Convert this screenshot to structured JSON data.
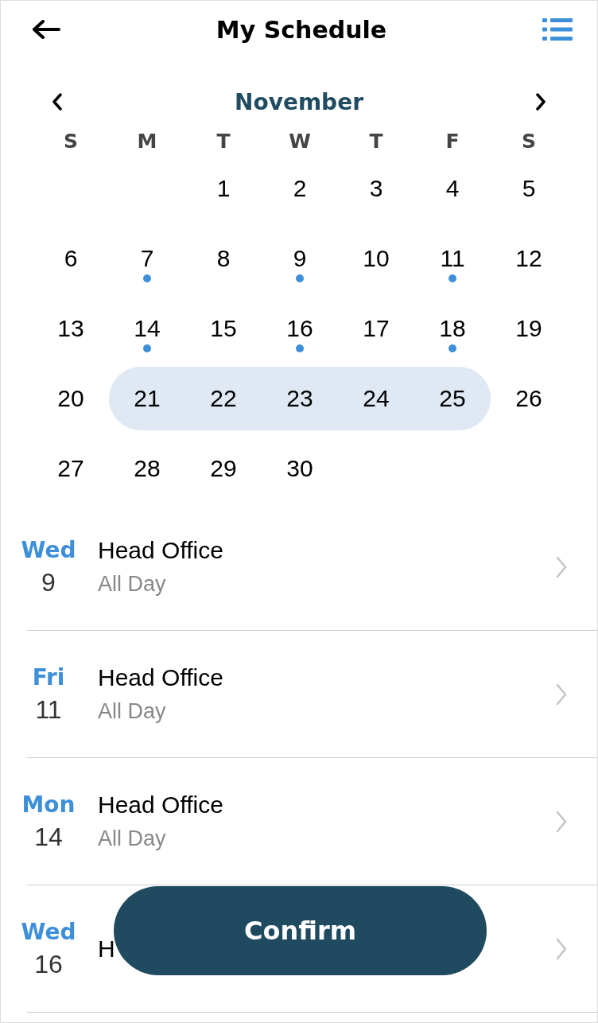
{
  "header": {
    "title": "My Schedule"
  },
  "calendar": {
    "month": "November",
    "weekdays": [
      "S",
      "M",
      "T",
      "W",
      "T",
      "F",
      "S"
    ],
    "weeks": [
      [
        {
          "label": "1",
          "has_event": false,
          "in_range": false
        },
        {
          "label": "2",
          "has_event": false,
          "in_range": false
        },
        {
          "label": "3",
          "has_event": false,
          "in_range": false
        },
        {
          "label": "4",
          "has_event": false,
          "in_range": false
        },
        {
          "label": "5",
          "has_event": false,
          "in_range": false
        }
      ],
      [
        {
          "label": "6",
          "has_event": false,
          "in_range": false
        },
        {
          "label": "7",
          "has_event": true,
          "in_range": false
        },
        {
          "label": "8",
          "has_event": false,
          "in_range": false
        },
        {
          "label": "9",
          "has_event": true,
          "in_range": false
        },
        {
          "label": "10",
          "has_event": false,
          "in_range": false
        },
        {
          "label": "11",
          "has_event": true,
          "in_range": false
        },
        {
          "label": "12",
          "has_event": false,
          "in_range": false
        }
      ],
      [
        {
          "label": "13",
          "has_event": false,
          "in_range": false
        },
        {
          "label": "14",
          "has_event": true,
          "in_range": false
        },
        {
          "label": "15",
          "has_event": false,
          "in_range": false
        },
        {
          "label": "16",
          "has_event": true,
          "in_range": false
        },
        {
          "label": "17",
          "has_event": false,
          "in_range": false
        },
        {
          "label": "18",
          "has_event": true,
          "in_range": false
        },
        {
          "label": "19",
          "has_event": false,
          "in_range": false
        }
      ],
      [
        {
          "label": "20",
          "has_event": false,
          "in_range": false
        },
        {
          "label": "21",
          "has_event": false,
          "in_range": true
        },
        {
          "label": "22",
          "has_event": false,
          "in_range": true
        },
        {
          "label": "23",
          "has_event": false,
          "in_range": true
        },
        {
          "label": "24",
          "has_event": false,
          "in_range": true
        },
        {
          "label": "25",
          "has_event": false,
          "in_range": true
        },
        {
          "label": "26",
          "has_event": false,
          "in_range": false
        }
      ],
      [
        {
          "label": "27",
          "has_event": false,
          "in_range": false
        },
        {
          "label": "28",
          "has_event": false,
          "in_range": false
        },
        {
          "label": "29",
          "has_event": false,
          "in_range": false
        },
        {
          "label": "30",
          "has_event": false,
          "in_range": false
        }
      ]
    ]
  },
  "schedule": [
    {
      "weekday": "Wed",
      "day": "9",
      "title": "Head Office",
      "time": "All Day"
    },
    {
      "weekday": "Fri",
      "day": "11",
      "title": "Head Office",
      "time": "All Day"
    },
    {
      "weekday": "Mon",
      "day": "14",
      "title": "Head Office",
      "time": "All Day"
    },
    {
      "weekday": "Wed",
      "day": "16",
      "title": "H"
    }
  ],
  "confirm_button": {
    "label": "Confirm"
  }
}
